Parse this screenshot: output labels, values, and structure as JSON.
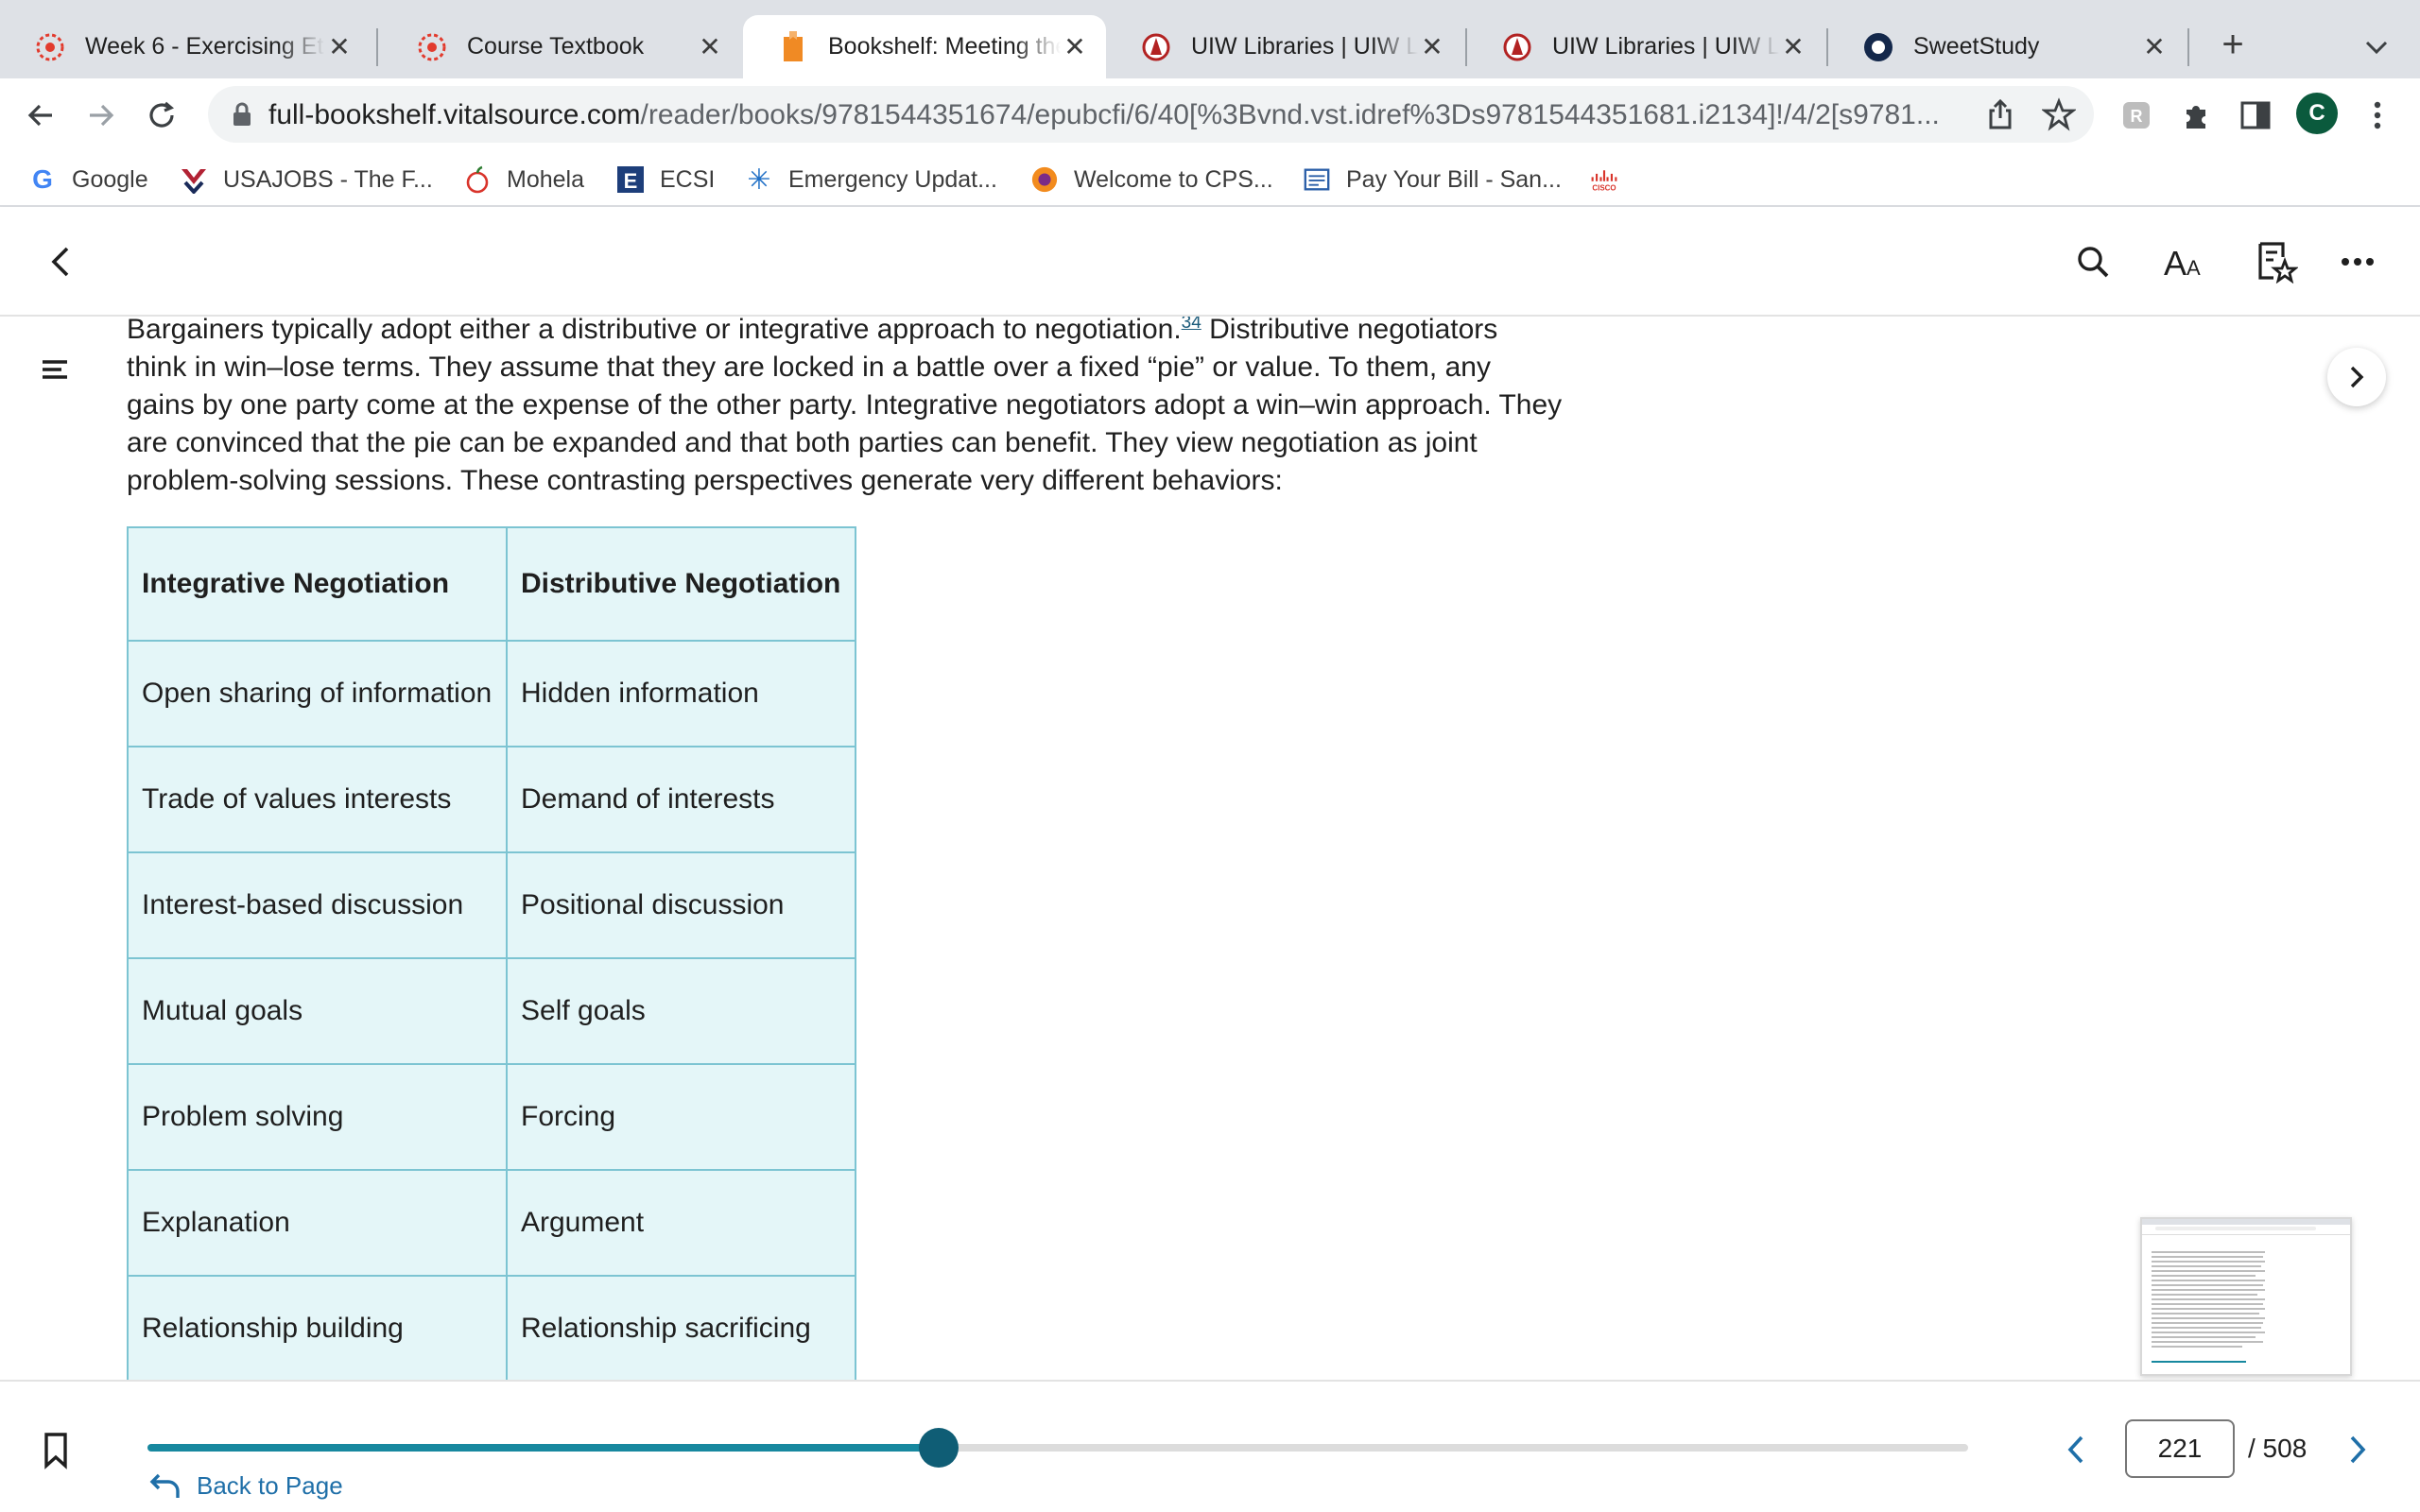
{
  "browser": {
    "tabs": [
      {
        "title": "Week 6 - Exercising Et",
        "icon": "canvas-star-icon"
      },
      {
        "title": "Course Textbook",
        "icon": "canvas-star-icon"
      },
      {
        "title": "Bookshelf: Meeting the",
        "icon": "bookshelf-icon",
        "active": true
      },
      {
        "title": "UIW Libraries | UIW Lib",
        "icon": "uiw-icon"
      },
      {
        "title": "UIW Libraries | UIW Lib",
        "icon": "uiw-icon"
      },
      {
        "title": "SweetStudy",
        "icon": "sweetstudy-icon"
      }
    ],
    "url_host": "full-bookshelf.vitalsource.com",
    "url_path": "/reader/books/9781544351674/epubcfi/6/40[%3Bvnd.vst.idref%3Ds9781544351681.i2134]!/4/2[s9781...",
    "profile_initial": "C",
    "bookmarks": [
      {
        "label": "Google",
        "icon": "google-icon"
      },
      {
        "label": "USAJOBS - The F...",
        "icon": "usajobs-icon"
      },
      {
        "label": "Mohela",
        "icon": "mohela-icon"
      },
      {
        "label": "ECSI",
        "icon": "ecsi-icon"
      },
      {
        "label": "Emergency Updat...",
        "icon": "snowflake-icon"
      },
      {
        "label": "Welcome to CPS...",
        "icon": "cps-icon"
      },
      {
        "label": "Pay Your Bill - San...",
        "icon": "bill-icon"
      },
      {
        "label": "",
        "icon": "cisco-icon"
      }
    ],
    "colors": {
      "tabstrip": "#dee1e6",
      "profile": "#0b5a3d",
      "accent": "#17889f"
    }
  },
  "reader": {
    "paragraph": {
      "before": "Bargainers typically adopt either a distributive or integrative approach to negotiation.",
      "footnote": "34",
      "after": " Distributive negotiators think in win–lose terms. They assume that they are locked in a battle over a fixed “pie” or value. To them, any gains by one party come at the expense of the other party. Integrative negotiators adopt a win–win approach. They are convinced that the pie can be expanded and that both parties can benefit. They view negotiation as joint problem-solving sessions. These contrasting perspectives generate very different behaviors:"
    },
    "table": {
      "headers": [
        "Integrative Negotiation",
        "Distributive Negotiation"
      ],
      "rows": [
        [
          "Open sharing of information",
          "Hidden information"
        ],
        [
          "Trade of values interests",
          "Demand of interests"
        ],
        [
          "Interest-based discussion",
          "Positional discussion"
        ],
        [
          "Mutual goals",
          "Self goals"
        ],
        [
          "Problem solving",
          "Forcing"
        ],
        [
          "Explanation",
          "Argument"
        ],
        [
          "Relationship building",
          "Relationship sacrificing"
        ]
      ]
    }
  },
  "footer": {
    "back_to_page": "Back to Page",
    "progress_fraction": 0.4345,
    "current_page": "221",
    "total_pages": "/ 508"
  }
}
